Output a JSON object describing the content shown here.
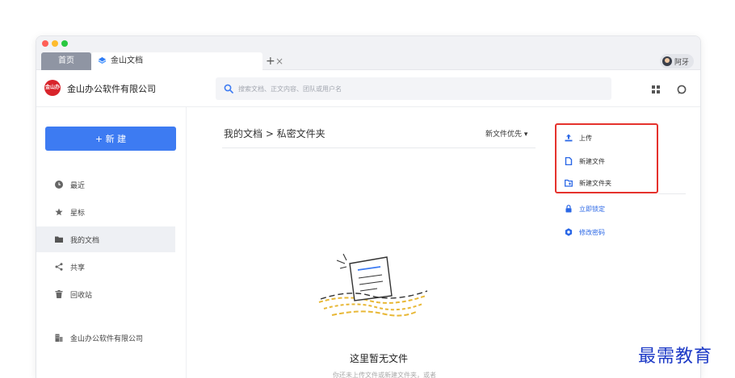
{
  "browser": {
    "tab_home": "首页",
    "tab_active": "金山文档",
    "tab_close": "×",
    "tab_add": "+",
    "user_name": "阿牙"
  },
  "app": {
    "company": "金山办公软件有限公司",
    "logo_text": "金山办公",
    "search_placeholder": "搜索文档、正文内容、团队或用户名"
  },
  "sidebar": {
    "new_button": "+ 新 建",
    "items": [
      {
        "label": "最近",
        "icon": "clock-icon"
      },
      {
        "label": "星标",
        "icon": "star-icon"
      },
      {
        "label": "我的文档",
        "icon": "folder-icon"
      },
      {
        "label": "共享",
        "icon": "share-icon"
      },
      {
        "label": "回收站",
        "icon": "trash-icon"
      }
    ],
    "org": "金山办公软件有限公司"
  },
  "main": {
    "breadcrumb": "我的文档 > 私密文件夹",
    "sort": "新文件优先 ▾",
    "empty_title": "这里暂无文件",
    "empty_sub": "你还未上传文件或新建文件夹，或者"
  },
  "actions": {
    "upload": "上传",
    "new_file": "新建文件",
    "new_folder": "新建文件夹",
    "lock": "立即锁定",
    "change_password": "修改密码"
  },
  "watermark": "最需教育",
  "colors": {
    "accent": "#3d7bf2",
    "highlight": "#e5322d",
    "watermark": "#1c39c6"
  }
}
